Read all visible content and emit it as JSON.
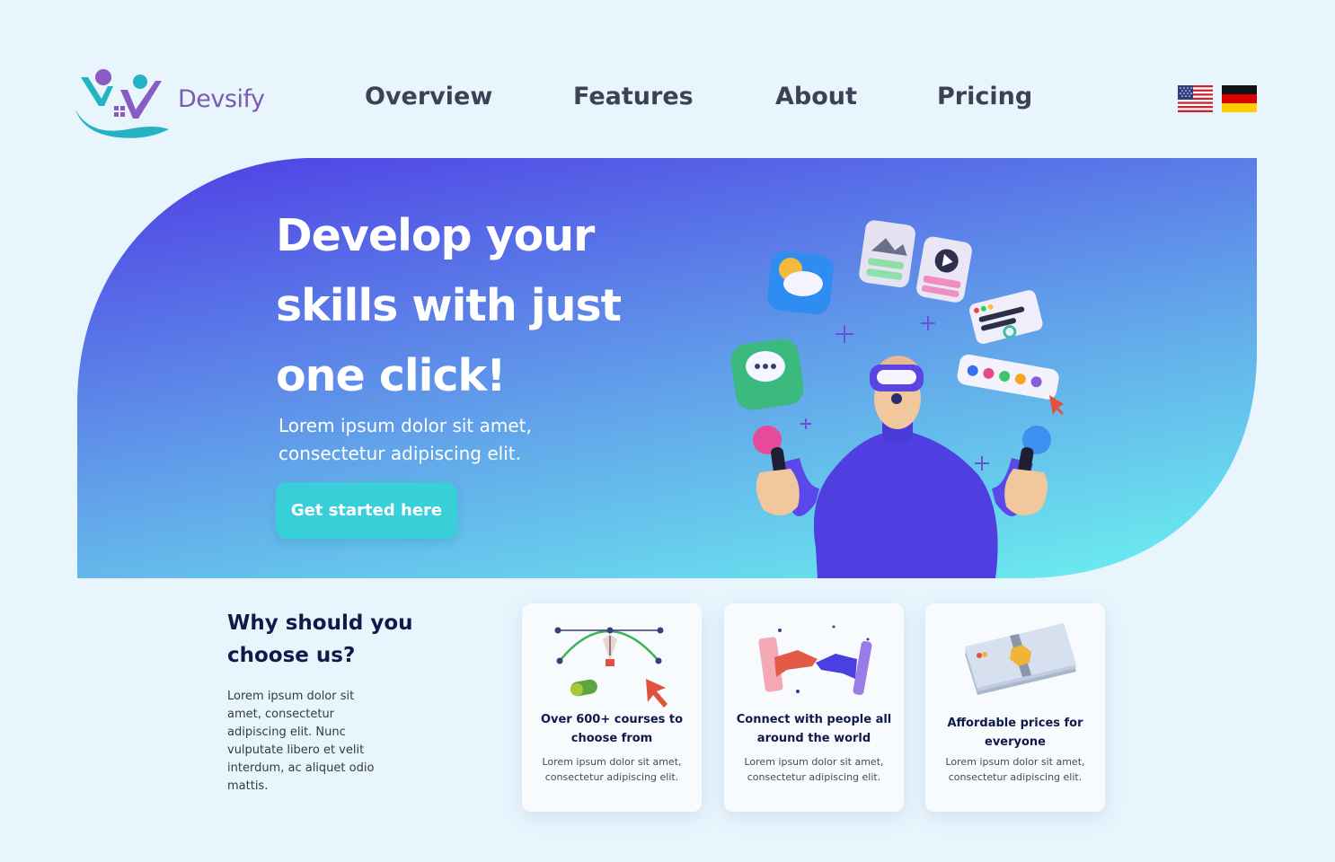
{
  "brand": {
    "name": "Devsify"
  },
  "nav": {
    "items": [
      {
        "label": "Overview"
      },
      {
        "label": "Features"
      },
      {
        "label": "About"
      },
      {
        "label": "Pricing"
      }
    ]
  },
  "languages": [
    "english-flag-icon",
    "german-flag-icon"
  ],
  "hero": {
    "title_lines": [
      "Develop your",
      "skills with just",
      "one click!"
    ],
    "subtitle_lines": [
      "Lorem ipsum dolor sit amet,",
      "consectetur adipiscing elit."
    ],
    "cta_label": "Get started here"
  },
  "why": {
    "title_lines": [
      "Why should you",
      "choose us?"
    ],
    "text_lines": [
      "Lorem ipsum dolor sit",
      "amet, consectetur",
      "adipiscing elit. Nunc",
      "vulputate libero et velit",
      "interdum, ac aliquet odio",
      "mattis."
    ]
  },
  "features": [
    {
      "icon": "vector-pen-icon",
      "title_lines": [
        "Over 600+ courses to",
        "choose from"
      ],
      "desc_lines": [
        "Lorem ipsum dolor sit amet,",
        "consectetur adipiscing elit."
      ]
    },
    {
      "icon": "handshake-icon",
      "title_lines": [
        "Connect with people all",
        "around the world"
      ],
      "desc_lines": [
        "Lorem ipsum dolor sit amet,",
        "consectetur adipiscing elit."
      ]
    },
    {
      "icon": "money-stack-icon",
      "title_lines": [
        "Affordable prices for",
        "everyone"
      ],
      "desc_lines": [
        "Lorem ipsum dolor sit amet,",
        "consectetur adipiscing elit."
      ]
    }
  ],
  "colors": {
    "background": "#e8f5fd",
    "hero_gradient_start": "#5048e5",
    "hero_gradient_end": "#6ae8ee",
    "cta": "#39cfd9",
    "heading_dark": "#101a4a",
    "nav_text": "#3c4256",
    "brand_purple": "#7b5bb0",
    "brand_teal": "#23b3c2"
  }
}
